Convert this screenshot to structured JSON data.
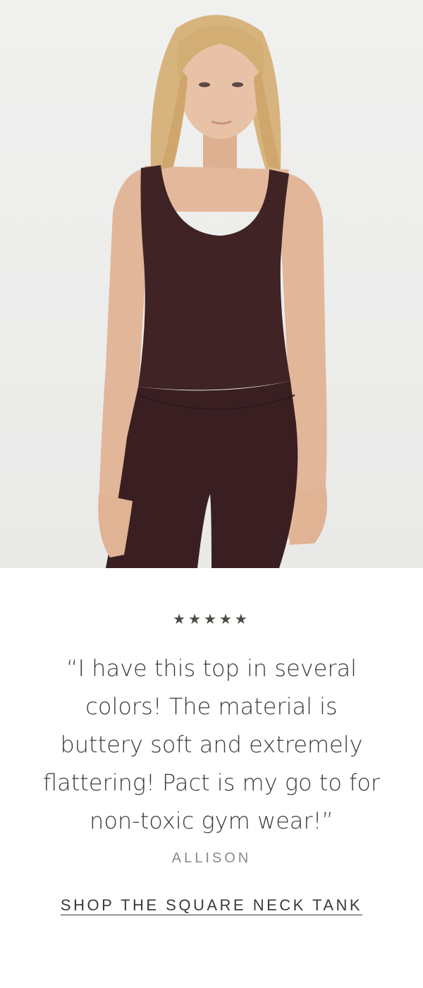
{
  "hero": {
    "image_name": "model-wearing-square-neck-tank",
    "colors": {
      "garment": "#3e2224",
      "skin": "#e3b79a",
      "hair": "#d6b27a",
      "background": "#eeeeed"
    }
  },
  "review": {
    "rating": 5,
    "stars": "★★★★★",
    "quote": "“I have this top in several colors! The material is buttery soft and extremely flattering! Pact is my go to for non-toxic gym wear!”",
    "author": "ALLISON",
    "cta_label": "SHOP THE SQUARE NECK TANK"
  }
}
